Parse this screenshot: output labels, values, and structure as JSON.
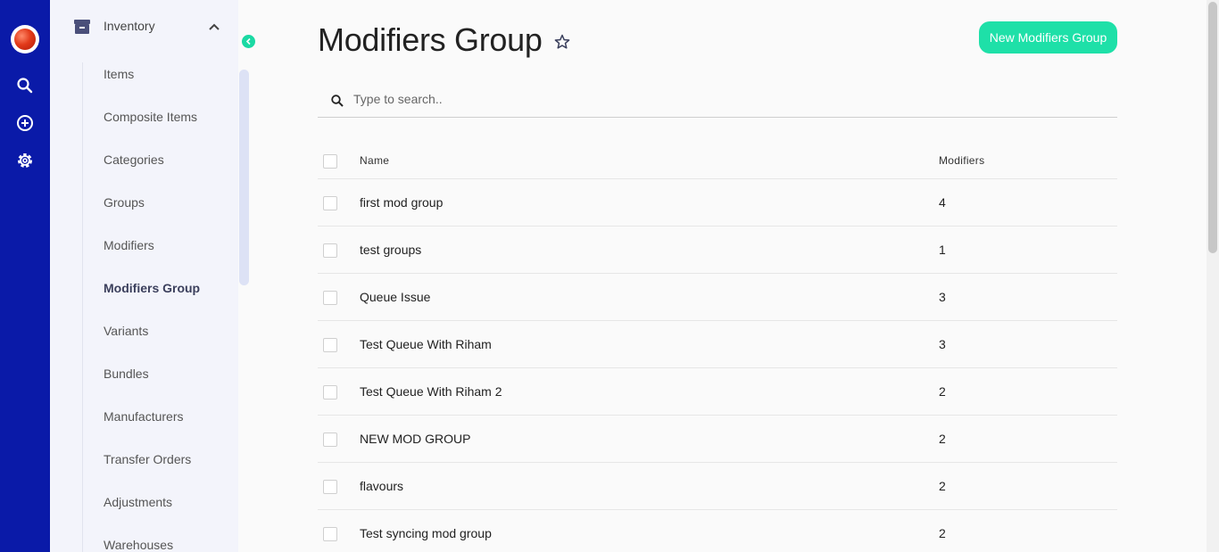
{
  "rail": {
    "icons": [
      "app-logo",
      "search-icon",
      "add-circle-icon",
      "settings-gear-icon"
    ]
  },
  "nav": {
    "section_label": "Inventory",
    "items": [
      {
        "label": "Items"
      },
      {
        "label": "Composite Items"
      },
      {
        "label": "Categories"
      },
      {
        "label": "Groups"
      },
      {
        "label": "Modifiers"
      },
      {
        "label": "Modifiers Group",
        "active": true
      },
      {
        "label": "Variants"
      },
      {
        "label": "Bundles"
      },
      {
        "label": "Manufacturers"
      },
      {
        "label": "Transfer Orders"
      },
      {
        "label": "Adjustments"
      },
      {
        "label": "Warehouses"
      }
    ]
  },
  "page": {
    "title": "Modifiers Group",
    "new_button_label": "New Modifiers Group"
  },
  "search": {
    "placeholder": "Type to search.."
  },
  "table": {
    "headers": {
      "name": "Name",
      "modifiers": "Modifiers"
    },
    "rows": [
      {
        "name": "first mod group",
        "modifiers": "4"
      },
      {
        "name": "test groups",
        "modifiers": "1"
      },
      {
        "name": "Queue Issue",
        "modifiers": "3"
      },
      {
        "name": "Test Queue With Riham",
        "modifiers": "3"
      },
      {
        "name": "Test Queue With Riham 2",
        "modifiers": "2"
      },
      {
        "name": "NEW MOD GROUP",
        "modifiers": "2"
      },
      {
        "name": "flavours",
        "modifiers": "2"
      },
      {
        "name": "Test syncing mod group",
        "modifiers": "2"
      }
    ]
  },
  "colors": {
    "rail": "#0a1aa8",
    "accent": "#1ee0a8",
    "nav_bg": "#f3f4fb"
  }
}
